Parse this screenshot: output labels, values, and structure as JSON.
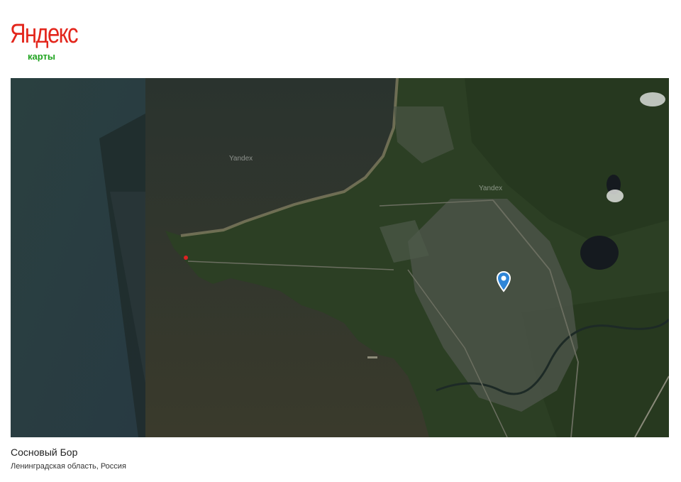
{
  "brand": {
    "logo_text": "Яндекс",
    "logo_sub": "карты",
    "logo_color": "#e3261c",
    "sub_color": "#1fa31f"
  },
  "map": {
    "view": "satellite",
    "watermark_labels": [
      "Yandex",
      "Yandex"
    ],
    "marker_icon": "location-pin-icon",
    "marker_color": "#2f86d8"
  },
  "place": {
    "name": "Сосновый Бор",
    "region": "Ленинградская область, Россия"
  }
}
